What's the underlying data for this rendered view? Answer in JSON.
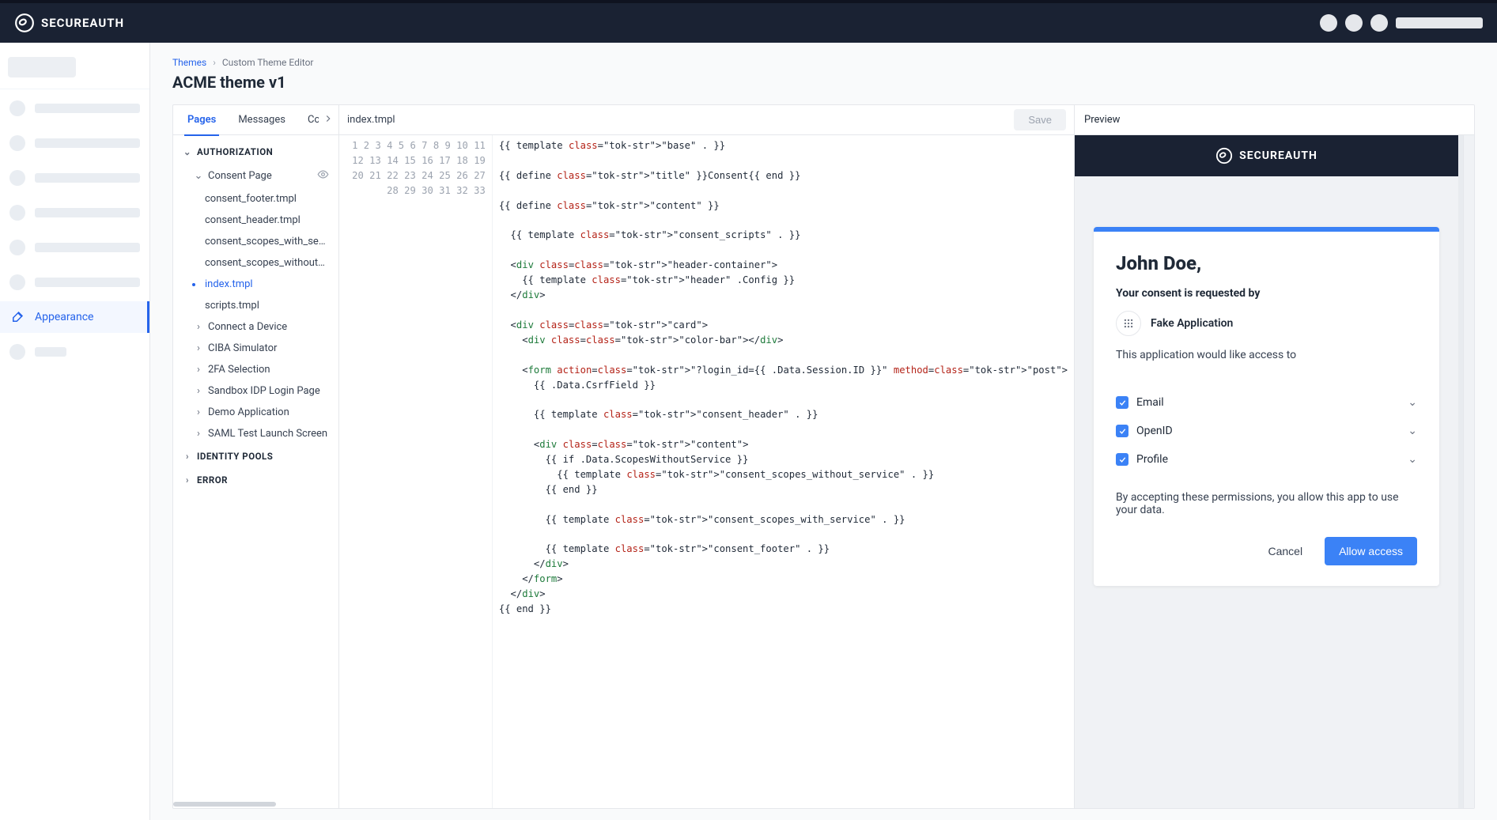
{
  "brand": "SECUREAUTH",
  "sidebar": {
    "active_label": "Appearance"
  },
  "breadcrumb": {
    "root": "Themes",
    "current": "Custom Theme Editor"
  },
  "page_title": "ACME theme v1",
  "tabs": {
    "pages": "Pages",
    "messages": "Messages",
    "components": "Components"
  },
  "save_label": "Save",
  "current_file": "index.tmpl",
  "tree": {
    "section1": "AUTHORIZATION",
    "consent_page": "Consent Page",
    "files": {
      "f0": "consent_footer.tmpl",
      "f1": "consent_header.tmpl",
      "f2": "consent_scopes_with_service.tmpl",
      "f3": "consent_scopes_without_service.tmpl",
      "f4": "index.tmpl",
      "f5": "scripts.tmpl"
    },
    "subs": {
      "s0": "Connect a Device",
      "s1": "CIBA Simulator",
      "s2": "2FA Selection",
      "s3": "Sandbox IDP Login Page",
      "s4": "Demo Application",
      "s5": "SAML Test Launch Screen"
    },
    "section2": "IDENTITY POOLS",
    "section3": "ERROR"
  },
  "code_lines": [
    "{{ template \"base\" . }}",
    "",
    "{{ define \"title\" }}Consent{{ end }}",
    "",
    "{{ define \"content\" }}",
    "",
    "  {{ template \"consent_scripts\" . }}",
    "",
    "  <div class=\"header-container\">",
    "    {{ template \"header\" .Config }}",
    "  </div>",
    "",
    "  <div class=\"card\">",
    "    <div class=\"color-bar\"></div>",
    "",
    "    <form action=\"?login_id={{ .Data.Session.ID }}\" method=\"post\">",
    "      {{ .Data.CsrfField }}",
    "",
    "      {{ template \"consent_header\" . }}",
    "",
    "      <div class=\"content\">",
    "        {{ if .Data.ScopesWithoutService }}",
    "          {{ template \"consent_scopes_without_service\" . }}",
    "        {{ end }}",
    "",
    "        {{ template \"consent_scopes_with_service\" . }}",
    "",
    "        {{ template \"consent_footer\" . }}",
    "      </div>",
    "    </form>",
    "  </div>",
    "{{ end }}",
    ""
  ],
  "preview": {
    "header": "Preview",
    "brand": "SECUREAUTH",
    "user": "John Doe,",
    "requested_by": "Your consent is requested by",
    "app_name": "Fake Application",
    "access_desc": "This application would like access to",
    "scopes": {
      "s0": "Email",
      "s1": "OpenID",
      "s2": "Profile"
    },
    "accept_text": "By accepting these permissions, you allow this app to use your data.",
    "cancel": "Cancel",
    "allow": "Allow access"
  }
}
